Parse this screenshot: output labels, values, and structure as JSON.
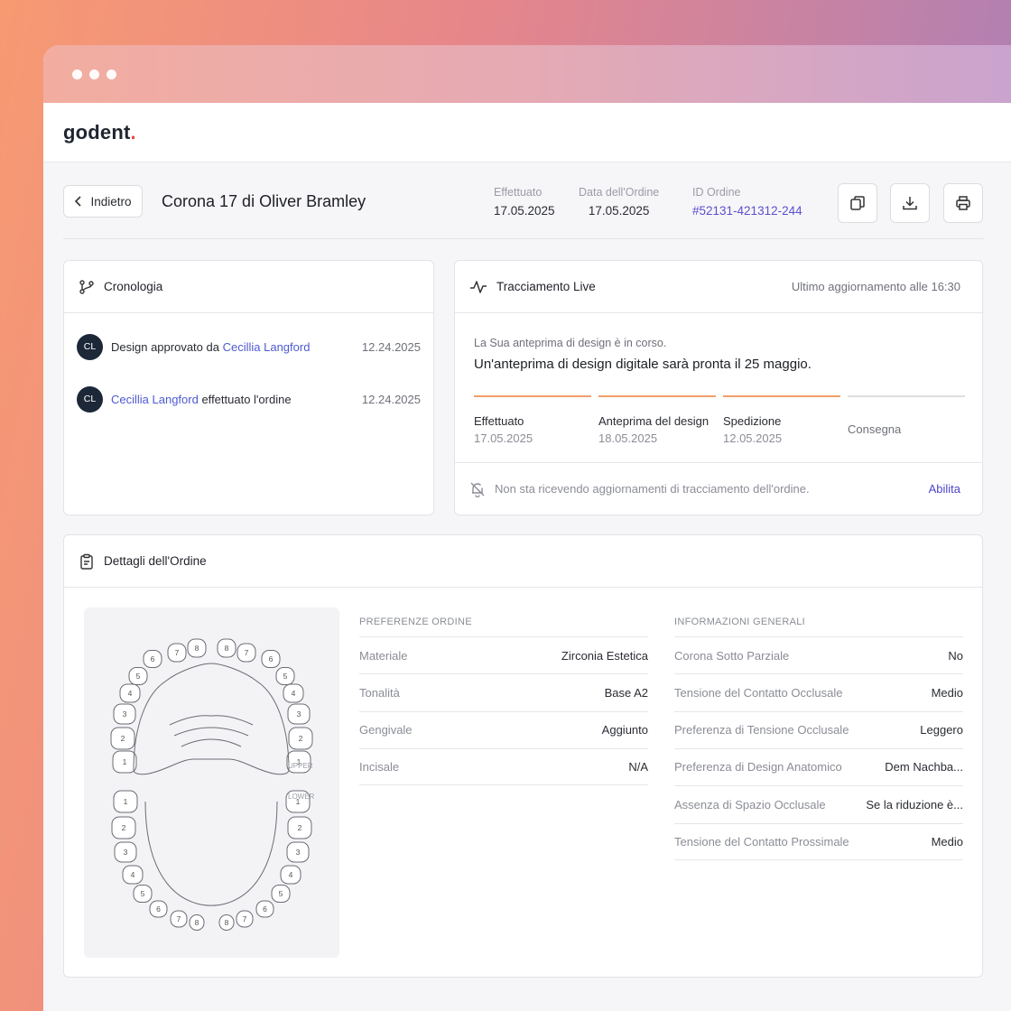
{
  "app": {
    "logo_text": "godent",
    "logo_dot": "."
  },
  "header": {
    "back_label": "Indietro",
    "title": "Corona 17 di Oliver Bramley",
    "meta": [
      {
        "label": "Effettuato",
        "value": "17.05.2025"
      },
      {
        "label": "Data dell'Ordine",
        "value": "17.05.2025"
      },
      {
        "label": "ID Ordine",
        "value": "#52131-421312-244"
      }
    ],
    "actions": [
      "copy-icon",
      "download-icon",
      "print-icon"
    ]
  },
  "timeline": {
    "title": "Cronologia",
    "items": [
      {
        "initials": "CL",
        "text_before": "Design approvato da ",
        "person": "Cecillia Langford",
        "text_after": "",
        "date": "12.24.2025"
      },
      {
        "initials": "CL",
        "text_before": "",
        "person": "Cecillia Langford",
        "text_after": " effettuato l'ordine",
        "date": "12.24.2025"
      }
    ]
  },
  "tracking": {
    "title": "Tracciamento Live",
    "updated": "Ultimo aggiornamento alle 16:30",
    "subtitle": "La Sua anteprima di design è in corso.",
    "headline": "Un'anteprima di design digitale sarà pronta il 25 maggio.",
    "steps": [
      {
        "label": "Effettuato",
        "date": "17.05.2025",
        "done": true
      },
      {
        "label": "Anteprima del design",
        "date": "18.05.2025",
        "done": true
      },
      {
        "label": "Spedizione",
        "date": "12.05.2025",
        "done": true
      },
      {
        "label": "Consegna",
        "date": "",
        "done": false
      }
    ],
    "notify_text": "Non sta ricevendo aggiornamenti di tracciamento dell'ordine.",
    "enable_label": "Abilita",
    "accent_color": "#f0a06a"
  },
  "details": {
    "title": "Dettagli dell'Ordine",
    "jaw": {
      "upper_label": "UPPER",
      "lower_label": "LOWER",
      "tooth_numbers": [
        "1",
        "2",
        "3",
        "4",
        "5",
        "6",
        "7",
        "8"
      ]
    },
    "preferences": {
      "title": "PREFERENZE ORDINE",
      "rows": [
        {
          "key": "Materiale",
          "value": "Zirconia Estetica"
        },
        {
          "key": "Tonalità",
          "value": "Base A2"
        },
        {
          "key": "Gengivale",
          "value": "Aggiunto"
        },
        {
          "key": "Incisale",
          "value": "N/A"
        }
      ]
    },
    "general": {
      "title": "INFORMAZIONI GENERALI",
      "rows": [
        {
          "key": "Corona Sotto Parziale",
          "value": "No"
        },
        {
          "key": "Tensione del Contatto Occlusale",
          "value": "Medio"
        },
        {
          "key": "Preferenza di Tensione Occlusale",
          "value": "Leggero"
        },
        {
          "key": "Preferenza di Design Anatomico",
          "value": "Dem Nachba..."
        },
        {
          "key": "Assenza di Spazio Occlusale",
          "value": "Se la riduzione è..."
        },
        {
          "key": "Tensione del Contatto Prossimale",
          "value": "Medio"
        }
      ]
    }
  }
}
